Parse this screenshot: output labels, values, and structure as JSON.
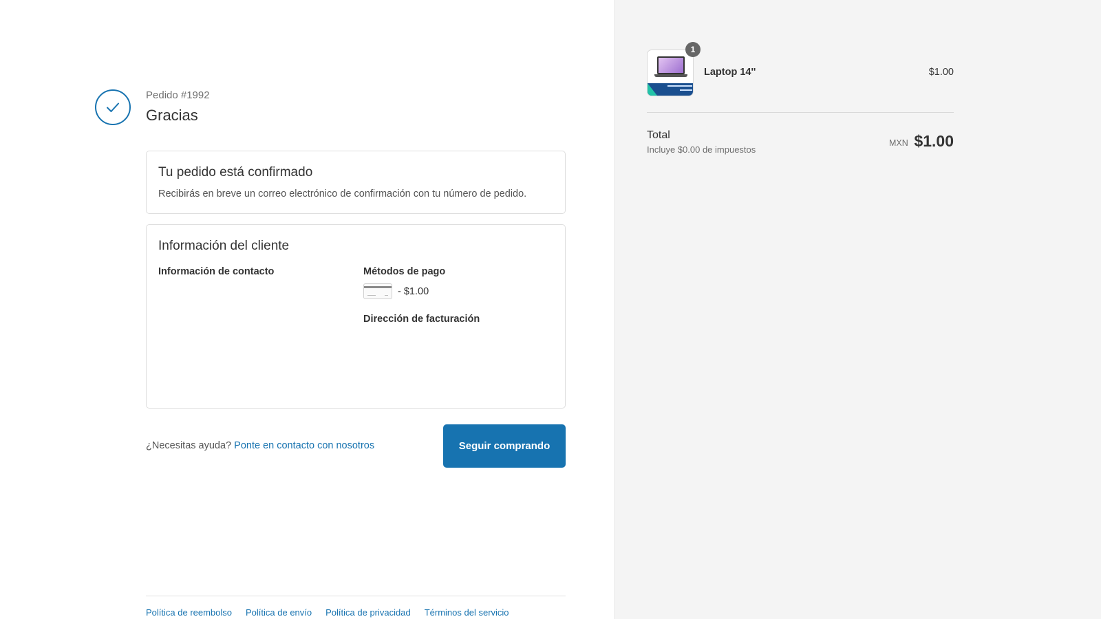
{
  "header": {
    "order_number": "Pedido #1992",
    "thanks": "Gracias"
  },
  "confirmation": {
    "title": "Tu pedido está confirmado",
    "text": "Recibirás en breve un correo electrónico de confirmación con tu número de pedido."
  },
  "customer_info": {
    "title": "Información del cliente",
    "contact_heading": "Información de contacto",
    "payment_heading": "Métodos de pago",
    "payment_amount": "- $1.00",
    "billing_heading": "Dirección de facturación"
  },
  "help": {
    "prefix": "¿Necesitas ayuda?",
    "link": "Ponte en contacto con nosotros"
  },
  "actions": {
    "continue_label": "Seguir comprando"
  },
  "footer": {
    "links": [
      "Política de reembolso",
      "Política de envío",
      "Política de privacidad",
      "Términos del servicio"
    ]
  },
  "summary": {
    "product": {
      "name": "Laptop 14''",
      "price": "$1.00",
      "quantity": "1"
    },
    "total_label": "Total",
    "tax_note": "Incluye $0.00 de impuestos",
    "currency": "MXN",
    "total_amount": "$1.00"
  },
  "colors": {
    "accent": "#1773b0",
    "summary_bg": "#f4f4f4"
  }
}
